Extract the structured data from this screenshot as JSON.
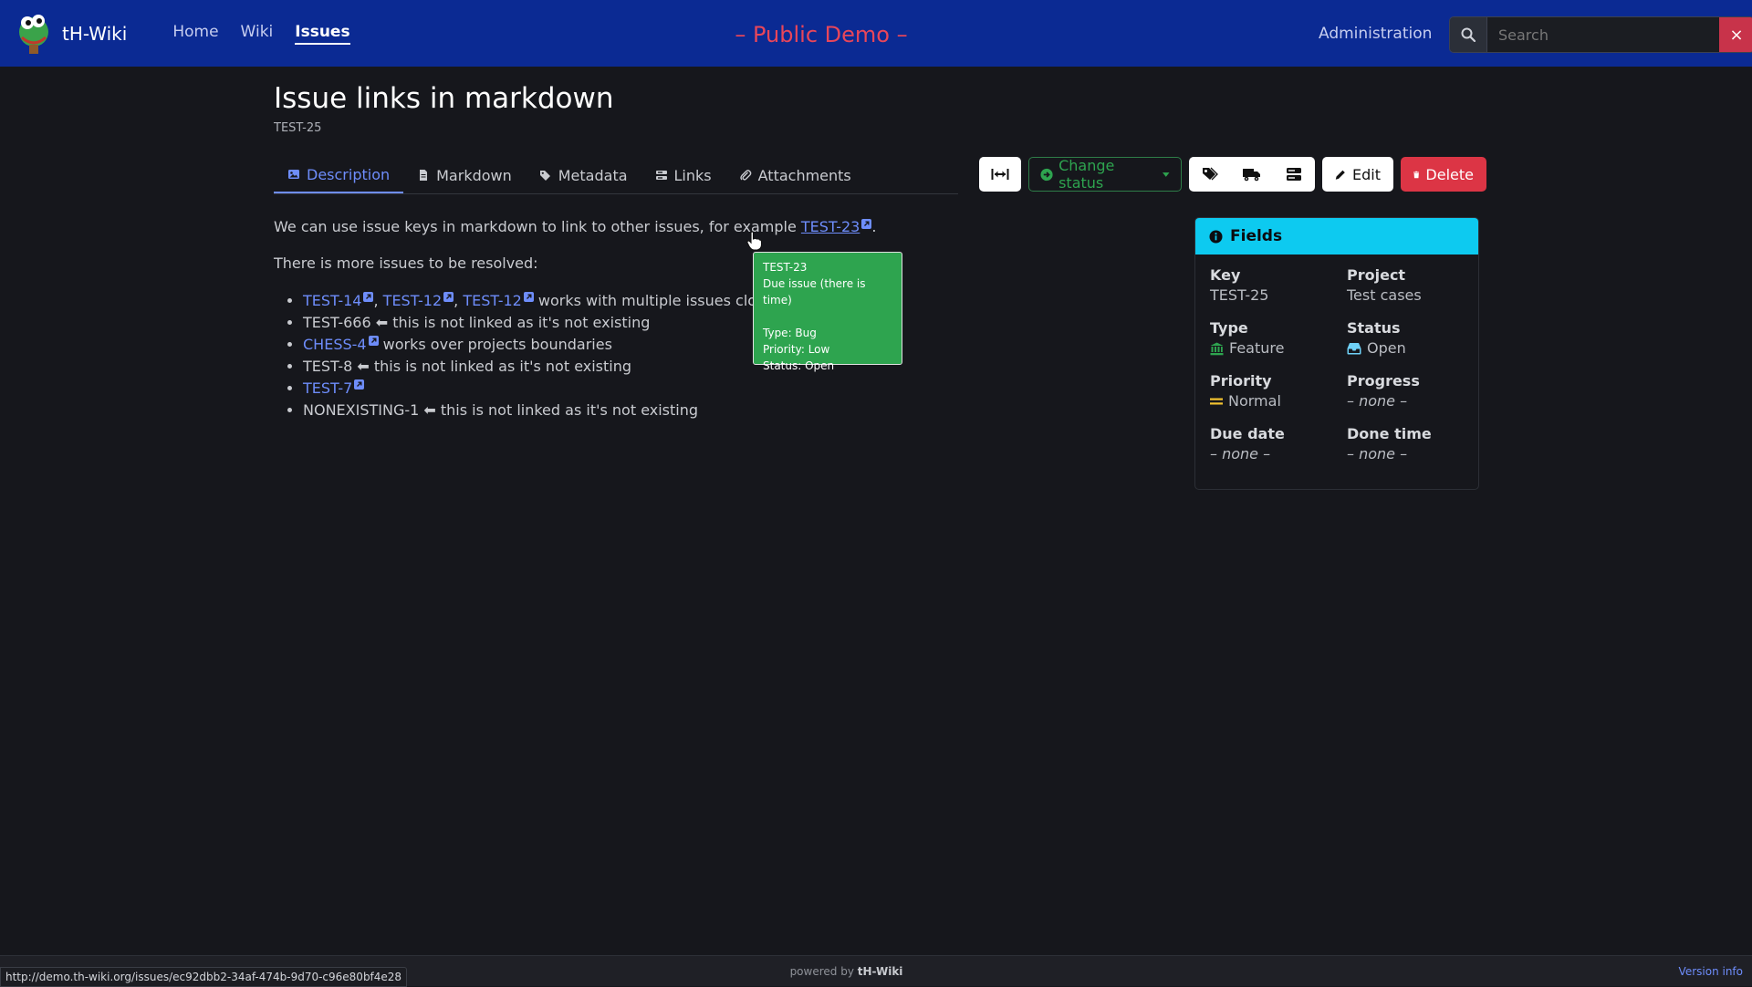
{
  "navbar": {
    "brand": "tH-Wiki",
    "links": [
      {
        "label": "Home"
      },
      {
        "label": "Wiki"
      },
      {
        "label": "Issues"
      }
    ],
    "demo_banner": "– Public Demo –",
    "admin": "Administration",
    "search_placeholder": "Search",
    "clear": "×"
  },
  "page": {
    "title": "Issue links in markdown",
    "key": "TEST-25"
  },
  "tabs": [
    {
      "label": "Description",
      "icon": "image-icon",
      "active": true
    },
    {
      "label": "Markdown",
      "icon": "file-icon"
    },
    {
      "label": "Metadata",
      "icon": "tags-icon"
    },
    {
      "label": "Links",
      "icon": "link-icon"
    },
    {
      "label": "Attachments",
      "icon": "paperclip-icon"
    }
  ],
  "toolbar": {
    "change_status": "Change status",
    "edit": "Edit",
    "delete": "Delete"
  },
  "content": {
    "p1_text": "We can use issue keys in markdown to link to other issues, for example ",
    "p1_link": "TEST-23",
    "p1_end": ".",
    "p2": "There is more issues to be resolved:",
    "li1_links": [
      "TEST-14",
      "TEST-12",
      "TEST-12"
    ],
    "li1_sep": ",",
    "li1_text": " works with multiple issues close together",
    "li2_key": "TEST-666",
    "li2_text": "this is not linked as it's not existing",
    "li3_link": "CHESS-4",
    "li3_text": " works over projects boundaries",
    "li4_key": "TEST-8",
    "li4_text": "this is not linked as it's not existing",
    "li5_link": "TEST-7",
    "li6_key": "NONEXISTING-1",
    "li6_text": "this is not linked as it's not existing",
    "arrow": "⬅"
  },
  "tooltip": {
    "key": "TEST-23",
    "title": "Due issue (there is time)",
    "type": "Type: Bug",
    "priority": "Priority: Low",
    "status": "Status: Open"
  },
  "fields": {
    "header": "Fields",
    "key_label": "Key",
    "key_value": "TEST-25",
    "project_label": "Project",
    "project_value": "Test cases",
    "type_label": "Type",
    "type_value": "Feature",
    "status_label": "Status",
    "status_value": "Open",
    "priority_label": "Priority",
    "priority_value": "Normal",
    "progress_label": "Progress",
    "progress_value": "– none –",
    "due_label": "Due date",
    "due_value": "– none –",
    "done_label": "Done time",
    "done_value": "– none –"
  },
  "footer": {
    "powered": "powered by ",
    "brand": "tH-Wiki",
    "version": "Version info",
    "status_url": "http://demo.th-wiki.org/issues/ec92dbb2-34af-474b-9d70-c96e80bf4e28"
  },
  "colors": {
    "navbar": "#0b2a93",
    "accent": "#6e8dfb",
    "success": "#2ea44f",
    "danger": "#dc3545",
    "info": "#0dcaf0",
    "banner": "#e8465a"
  }
}
